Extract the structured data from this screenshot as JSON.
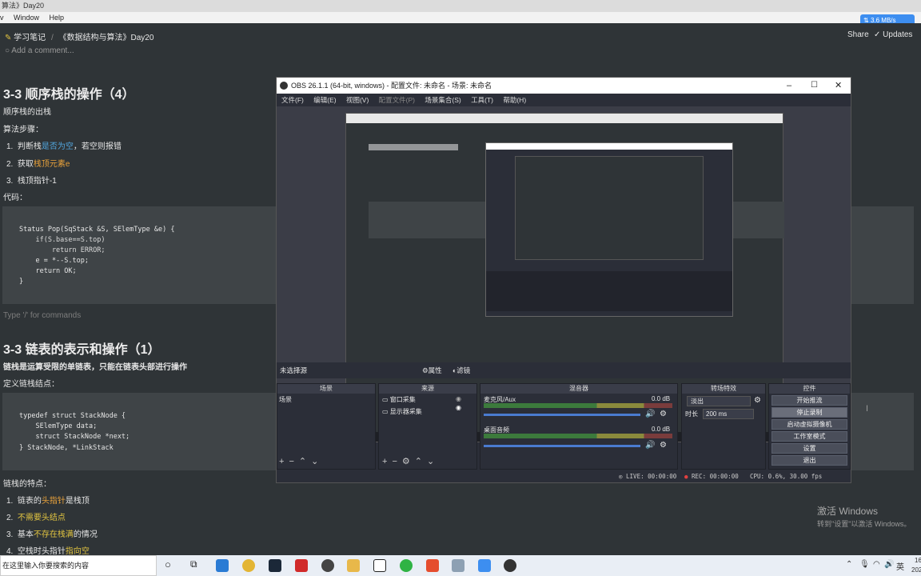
{
  "window": {
    "title": "算法》Day20",
    "menu": [
      "v",
      "Window",
      "Help"
    ],
    "net_speed": "3.6 MB/s"
  },
  "breadcrumb": {
    "workspace": "学习笔记",
    "page": "《数据结构与算法》Day20"
  },
  "topbar": {
    "share": "Share",
    "updates": "Updates",
    "comment_placeholder": "Add a comment..."
  },
  "doc": {
    "h1": "3-3 顺序栈的操作（4）",
    "sub1": "顺序栈的出栈",
    "steps_label": "算法步骤：",
    "steps": [
      {
        "num": "1.",
        "prefix": "判断栈",
        "hl": "是否为空",
        "suffix": "，若空则报错"
      },
      {
        "num": "2.",
        "prefix": "获取",
        "hl": "栈顶元素e",
        "suffix": ""
      },
      {
        "num": "3.",
        "prefix": "栈顶指针-1",
        "hl": "",
        "suffix": ""
      }
    ],
    "code_label": "代码：",
    "code1": [
      "Status Pop(SqStack &S, SElemType &e) {",
      "    if(S.base==S.top)",
      "        return ERROR;",
      "    e = *--S.top;",
      "    return OK;",
      "}"
    ],
    "placeholder": "Type '/' for commands",
    "h2": "3-3 链表的表示和操作（1）",
    "sub2": "链栈是运算受限的单链表，只能在链表头部进行操作",
    "def_label": "定义链栈结点：",
    "code2": [
      "typedef struct StackNode {",
      "    SElemType data;",
      "    struct StackNode *next;",
      "} StackNode, *LinkStack"
    ],
    "features_label": "链栈的特点：",
    "features": [
      {
        "num": "1.",
        "prefix": "链表的",
        "hl": "头指针",
        "suffix": "是栈顶"
      },
      {
        "num": "2.",
        "prefix": "",
        "hl": "不需要头结点",
        "suffix": ""
      },
      {
        "num": "3.",
        "prefix": "基本",
        "hl": "不存在栈满",
        "suffix": "的情况"
      },
      {
        "num": "4.",
        "prefix": "空栈时头指针",
        "hl": "指向空",
        "suffix": ""
      }
    ]
  },
  "obs": {
    "title": "OBS 26.1.1 (64-bit, windows) - 配置文件: 未命名 - 场景: 未命名",
    "menu": [
      "文件(F)",
      "编辑(E)",
      "视图(V)",
      "配置文件(P)",
      "场景集合(S)",
      "工具(T)",
      "帮助(H)"
    ],
    "source_bar": {
      "label": "未选择源",
      "props": "属性",
      "filters": "滤镜"
    },
    "docks": {
      "scenes": {
        "title": "场景",
        "items": [
          "场景"
        ]
      },
      "sources": {
        "title": "来源",
        "items": [
          "窗口采集",
          "显示器采集"
        ]
      },
      "mixer": {
        "title": "混音器",
        "channels": [
          {
            "name": "麦克风/Aux",
            "db": "0.0 dB"
          },
          {
            "name": "桌面音频",
            "db": "0.0 dB"
          }
        ]
      },
      "transitions": {
        "title": "转场特效",
        "type": "淡出",
        "duration_label": "时长",
        "duration": "200 ms"
      },
      "controls": {
        "title": "控件",
        "buttons": [
          "开始推流",
          "停止录制",
          "启动虚拟摄像机",
          "工作室模式",
          "设置",
          "退出"
        ]
      }
    },
    "status": {
      "live": "LIVE: 00:00:00",
      "rec": "REC: 00:00:00",
      "cpu": "CPU: 0.6%, 30.00 fps"
    }
  },
  "taskbar": {
    "search_placeholder": "在这里输入你要搜索的内容",
    "lang": "英",
    "time": "16",
    "date": "202"
  },
  "watermark": {
    "line1": "激活 Windows",
    "line2": "转到\"设置\"以激活 Windows。"
  }
}
